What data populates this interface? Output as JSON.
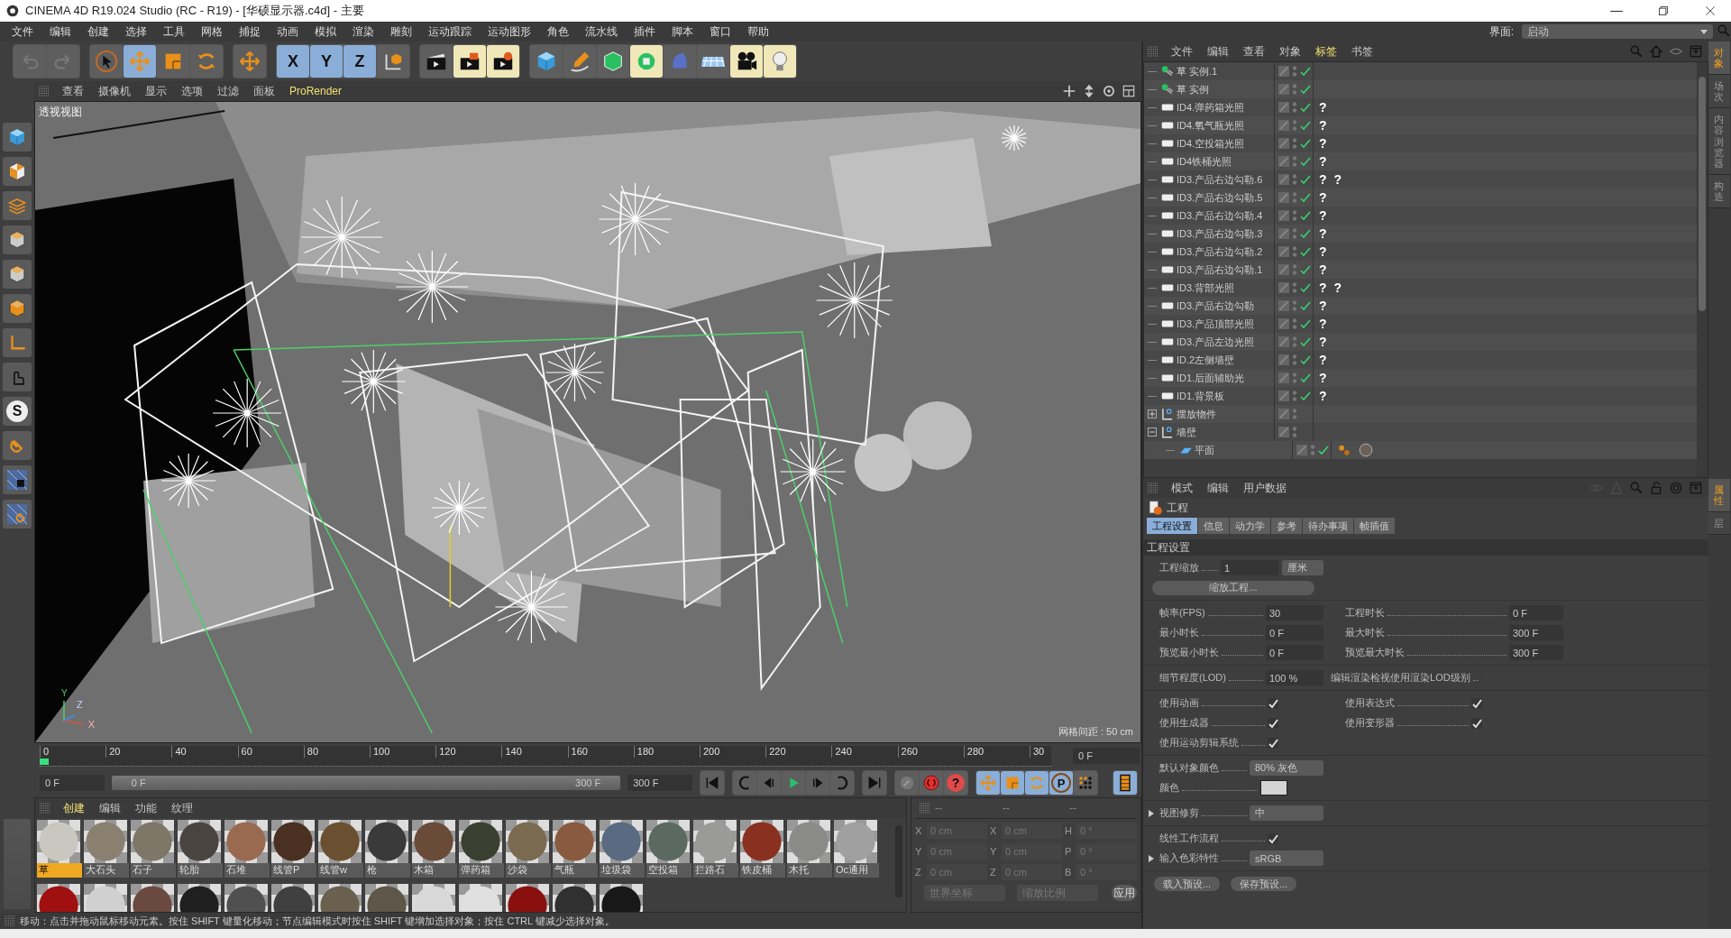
{
  "window": {
    "title": "CINEMA 4D R19.024 Studio (RC - R19) - [华硕显示器.c4d] - 主要"
  },
  "menu": [
    "文件",
    "编辑",
    "创建",
    "选择",
    "工具",
    "网格",
    "捕捉",
    "动画",
    "模拟",
    "渲染",
    "雕刻",
    "运动跟踪",
    "运动图形",
    "角色",
    "流水线",
    "插件",
    "脚本",
    "窗口",
    "帮助"
  ],
  "layout_picker": {
    "label": "界面:",
    "value": "启动"
  },
  "toolbar": {
    "tools": [
      {
        "kind": "select",
        "selected": false
      },
      {
        "kind": "move",
        "selected": true
      },
      {
        "kind": "scale",
        "selected": false
      },
      {
        "kind": "rotate",
        "selected": false
      }
    ],
    "axes": [
      {
        "label": "X",
        "on": true
      },
      {
        "label": "Y",
        "on": true
      },
      {
        "label": "Z",
        "on": true
      }
    ]
  },
  "left_toolbar": {
    "letter_button": "S"
  },
  "viewport": {
    "menu": [
      {
        "label": "查看",
        "highlighted": false
      },
      {
        "label": "摄像机",
        "highlighted": false
      },
      {
        "label": "显示",
        "highlighted": false
      },
      {
        "label": "选项",
        "highlighted": false
      },
      {
        "label": "过滤",
        "highlighted": false
      },
      {
        "label": "面板",
        "highlighted": false
      },
      {
        "label": "ProRender",
        "highlighted": true
      }
    ],
    "view_name": "透视视图",
    "grid_spacing": "网格间距 : 50 cm",
    "axis_labels": [
      "Y",
      "X",
      "Z"
    ]
  },
  "timeline": {
    "ticks": [
      "0",
      "20",
      "40",
      "60",
      "80",
      "100",
      "120",
      "140",
      "160",
      "180",
      "200",
      "220",
      "240",
      "260",
      "280",
      "30"
    ],
    "playhead": {
      "level": 0
    },
    "current_frame": "0 F",
    "range_start_field": "0 F",
    "range_fill": {
      "level": 1
    },
    "range_start": "0 F",
    "range_end": "300 F",
    "range_end_field": "300 F",
    "key_tracks": [
      {
        "kind": "move",
        "on": true
      },
      {
        "kind": "scale",
        "on": true
      },
      {
        "kind": "rotate",
        "on": true
      },
      {
        "kind": "param",
        "glyph": "P",
        "on": true
      },
      {
        "kind": "pla",
        "on": false
      }
    ],
    "autokey_glyph": "?"
  },
  "materials": {
    "menu": [
      {
        "label": "创建",
        "highlighted": true
      },
      {
        "label": "编辑",
        "highlighted": false
      },
      {
        "label": "功能",
        "highlighted": false
      },
      {
        "label": "纹理",
        "highlighted": false
      }
    ],
    "items": [
      {
        "name": "草",
        "color": "#c8c8c0",
        "selected": true
      },
      {
        "name": "大石头",
        "color": "#8a8070",
        "selected": false
      },
      {
        "name": "石子",
        "color": "#7e7666",
        "selected": false
      },
      {
        "name": "轮胎",
        "color": "#4a4440",
        "selected": false
      },
      {
        "name": "石堆",
        "color": "#9a6a50",
        "selected": false
      },
      {
        "name": "线管P",
        "color": "#4a3020",
        "selected": false
      },
      {
        "name": "线管w",
        "color": "#6a5030",
        "selected": false
      },
      {
        "name": "枪",
        "color": "#3a3a3a",
        "selected": false
      },
      {
        "name": "木箱",
        "color": "#6a4a38",
        "selected": false
      },
      {
        "name": "弹药箱",
        "color": "#3a4030",
        "selected": false
      },
      {
        "name": "沙袋",
        "color": "#7a6a50",
        "selected": false
      },
      {
        "name": "气瓶",
        "color": "#8a5a40",
        "selected": false
      },
      {
        "name": "垃圾袋",
        "color": "#5a6a80",
        "selected": false
      },
      {
        "name": "空投箱",
        "color": "#5a6a60",
        "selected": false
      },
      {
        "name": "拦路石",
        "color": "#9a9a98",
        "selected": false
      },
      {
        "name": "铁皮桶",
        "color": "#8a3020",
        "selected": false
      },
      {
        "name": "木托",
        "color": "#8a8a88",
        "selected": false
      },
      {
        "name": "Oc通用",
        "color": "#a0a0a0",
        "selected": false
      }
    ],
    "more": [
      {
        "color": "#a01010"
      },
      {
        "color": "#d0d0d0"
      },
      {
        "color": "#6a4a40"
      },
      {
        "color": "#202020"
      },
      {
        "color": "#505050"
      },
      {
        "color": "#404040"
      },
      {
        "color": "#6a6050"
      },
      {
        "color": "#5e5648"
      },
      {
        "color": "#d8d8d8"
      },
      {
        "color": "#e0e0e0"
      },
      {
        "color": "#8a1010"
      },
      {
        "color": "#303030"
      },
      {
        "color": "#181818"
      }
    ]
  },
  "coordinates": {
    "headers": [
      "--",
      "--",
      "--"
    ],
    "rows": [
      {
        "axes": [
          "X",
          "X",
          "H"
        ],
        "values": [
          "0 cm",
          "0 cm",
          "0 °"
        ]
      },
      {
        "axes": [
          "Y",
          "Y",
          "P"
        ],
        "values": [
          "0 cm",
          "0 cm",
          "0 °"
        ]
      },
      {
        "axes": [
          "Z",
          "Z",
          "B"
        ],
        "values": [
          "0 cm",
          "0 cm",
          "0 °"
        ]
      }
    ],
    "mode": "世界坐标",
    "scale_mode": "缩放比例",
    "apply": "应用"
  },
  "status_bar": "移动：点击并拖动鼠标移动元素。按住 SHIFT 键量化移动；节点编辑模式时按住 SHIFT 键增加选择对象；按住 CTRL 键减少选择对象。",
  "objects": {
    "menu": [
      {
        "label": "文件",
        "highlighted": false
      },
      {
        "label": "编辑",
        "highlighted": false
      },
      {
        "label": "查看",
        "highlighted": false
      },
      {
        "label": "对象",
        "highlighted": false
      },
      {
        "label": "标签",
        "highlighted": true
      },
      {
        "label": "书签",
        "highlighted": false
      }
    ],
    "rows": [
      {
        "name": "草 实例.1",
        "kind": "instance",
        "enabled": true,
        "tags": []
      },
      {
        "name": "草 实例",
        "kind": "instance",
        "enabled": true,
        "tags": []
      },
      {
        "name": "ID4.弹药箱光照",
        "kind": "light",
        "enabled": true,
        "tags": [
          {
            "kind": "unknown",
            "glyph": "?"
          }
        ]
      },
      {
        "name": "ID4.氧气瓶光照",
        "kind": "light",
        "enabled": true,
        "tags": [
          {
            "kind": "unknown",
            "glyph": "?"
          }
        ]
      },
      {
        "name": "ID4.空投箱光照",
        "kind": "light",
        "enabled": true,
        "tags": [
          {
            "kind": "unknown",
            "glyph": "?"
          }
        ]
      },
      {
        "name": "ID4铁桶光照",
        "kind": "light",
        "enabled": true,
        "tags": [
          {
            "kind": "unknown",
            "glyph": "?"
          }
        ]
      },
      {
        "name": "ID3.产品右边勾勒.6",
        "kind": "light",
        "enabled": true,
        "tags": [
          {
            "kind": "unknown",
            "glyph": "?"
          },
          {
            "kind": "unknown",
            "glyph": "?"
          }
        ]
      },
      {
        "name": "ID3.产品右边勾勒.5",
        "kind": "light",
        "enabled": true,
        "tags": [
          {
            "kind": "unknown",
            "glyph": "?"
          }
        ]
      },
      {
        "name": "ID3.产品右边勾勒.4",
        "kind": "light",
        "enabled": true,
        "tags": [
          {
            "kind": "unknown",
            "glyph": "?"
          }
        ]
      },
      {
        "name": "ID3.产品右边勾勒.3",
        "kind": "light",
        "enabled": true,
        "tags": [
          {
            "kind": "unknown",
            "glyph": "?"
          }
        ]
      },
      {
        "name": "ID3.产品右边勾勒.2",
        "kind": "light",
        "enabled": true,
        "tags": [
          {
            "kind": "unknown",
            "glyph": "?"
          }
        ]
      },
      {
        "name": "ID3.产品右边勾勒.1",
        "kind": "light",
        "enabled": true,
        "tags": [
          {
            "kind": "unknown",
            "glyph": "?"
          }
        ]
      },
      {
        "name": "ID3.背部光照",
        "kind": "light",
        "enabled": true,
        "tags": [
          {
            "kind": "unknown",
            "glyph": "?"
          },
          {
            "kind": "unknown",
            "glyph": "?"
          }
        ]
      },
      {
        "name": "ID3.产品右边勾勒",
        "kind": "light",
        "enabled": true,
        "tags": [
          {
            "kind": "unknown",
            "glyph": "?"
          }
        ]
      },
      {
        "name": "ID3.产品顶部光照",
        "kind": "light",
        "enabled": true,
        "tags": [
          {
            "kind": "unknown",
            "glyph": "?"
          }
        ]
      },
      {
        "name": "ID3.产品左边光照",
        "kind": "light",
        "enabled": true,
        "tags": [
          {
            "kind": "unknown",
            "glyph": "?"
          }
        ]
      },
      {
        "name": "ID.2左侧墙壁",
        "kind": "light",
        "enabled": true,
        "tags": [
          {
            "kind": "unknown",
            "glyph": "?"
          }
        ]
      },
      {
        "name": "ID1.后面辅助光",
        "kind": "light",
        "enabled": true,
        "tags": [
          {
            "kind": "unknown",
            "glyph": "?"
          }
        ]
      },
      {
        "name": "ID1.背景板",
        "kind": "light",
        "enabled": true,
        "tags": [
          {
            "kind": "unknown",
            "glyph": "?"
          }
        ]
      },
      {
        "name": "摆放物件",
        "kind": "null",
        "enabled": false,
        "expanded": false,
        "tags": []
      },
      {
        "name": "墙壁",
        "kind": "null",
        "enabled": false,
        "expanded": true,
        "tags": [],
        "children": [
          {
            "name": "平面",
            "kind": "plane",
            "enabled": true,
            "tags": [
              {
                "kind": "phong"
              },
              {
                "kind": "material"
              }
            ]
          }
        ]
      }
    ]
  },
  "attributes": {
    "menu": [
      "模式",
      "编辑",
      "用户数据"
    ],
    "title": "工程",
    "tabs": [
      {
        "label": "工程设置",
        "selected": true
      },
      {
        "label": "信息",
        "selected": false
      },
      {
        "label": "动力学",
        "selected": false
      },
      {
        "label": "参考",
        "selected": false
      },
      {
        "label": "待办事项",
        "selected": false
      },
      {
        "label": "帧插值",
        "selected": false
      }
    ],
    "section": "工程设置",
    "groups": [
      [
        {
          "left": {
            "kind": "number_unit",
            "label": "工程缩放",
            "value": "1",
            "unit": "厘米"
          }
        },
        {
          "left": {
            "kind": "button",
            "label": "缩放工程..."
          }
        }
      ],
      [
        {
          "left": {
            "kind": "number",
            "label": "帧率(FPS)",
            "value": "30"
          },
          "right": {
            "kind": "number",
            "label": "工程时长",
            "value": "0 F"
          }
        },
        {
          "left": {
            "kind": "number",
            "label": "最小时长",
            "value": "0 F"
          },
          "right": {
            "kind": "number",
            "label": "最大时长",
            "value": "300 F"
          }
        },
        {
          "left": {
            "kind": "number",
            "label": "预览最小时长",
            "value": "0 F"
          },
          "right": {
            "kind": "number",
            "label": "预览最大时长",
            "value": "300 F"
          }
        }
      ],
      [
        {
          "left": {
            "kind": "number",
            "label": "细节程度(LOD)",
            "value": "100 %"
          },
          "right": {
            "kind": "checkbox",
            "label": "编辑渲染检视使用渲染LOD级别",
            "checked": false
          }
        }
      ],
      [
        {
          "left": {
            "kind": "checkbox",
            "label": "使用动画",
            "checked": true
          },
          "right": {
            "kind": "checkbox",
            "label": "使用表达式",
            "checked": true
          }
        },
        {
          "left": {
            "kind": "checkbox",
            "label": "使用生成器",
            "checked": true
          },
          "right": {
            "kind": "checkbox",
            "label": "使用变形器",
            "checked": true
          }
        },
        {
          "left": {
            "kind": "checkbox",
            "label": "使用运动剪辑系统",
            "checked": true
          }
        }
      ],
      [
        {
          "left": {
            "kind": "dropdown",
            "label": "默认对象颜色",
            "value": "80% 灰色"
          }
        },
        {
          "left": {
            "kind": "color",
            "label": "颜色",
            "color": "#d4d4d4"
          }
        }
      ],
      [
        {
          "left": {
            "kind": "dropdown",
            "label": "视图修剪",
            "value": "中",
            "expandable": true
          }
        }
      ],
      [
        {
          "left": {
            "kind": "checkbox",
            "label": "线性工作流程",
            "checked": true
          }
        },
        {
          "left": {
            "kind": "dropdown",
            "label": "输入色彩特性",
            "value": "sRGB",
            "expandable": true
          }
        }
      ]
    ],
    "buttons": [
      "载入预设...",
      "保存预设..."
    ]
  },
  "side_tabs_top": [
    {
      "label": "对象",
      "selected": true
    },
    {
      "label": "场次",
      "selected": false
    },
    {
      "label": "内容浏览器",
      "selected": false
    },
    {
      "label": "构造",
      "selected": false
    }
  ],
  "side_tabs_bottom": [
    {
      "label": "属性",
      "selected": true
    },
    {
      "label": "层",
      "selected": false
    }
  ]
}
